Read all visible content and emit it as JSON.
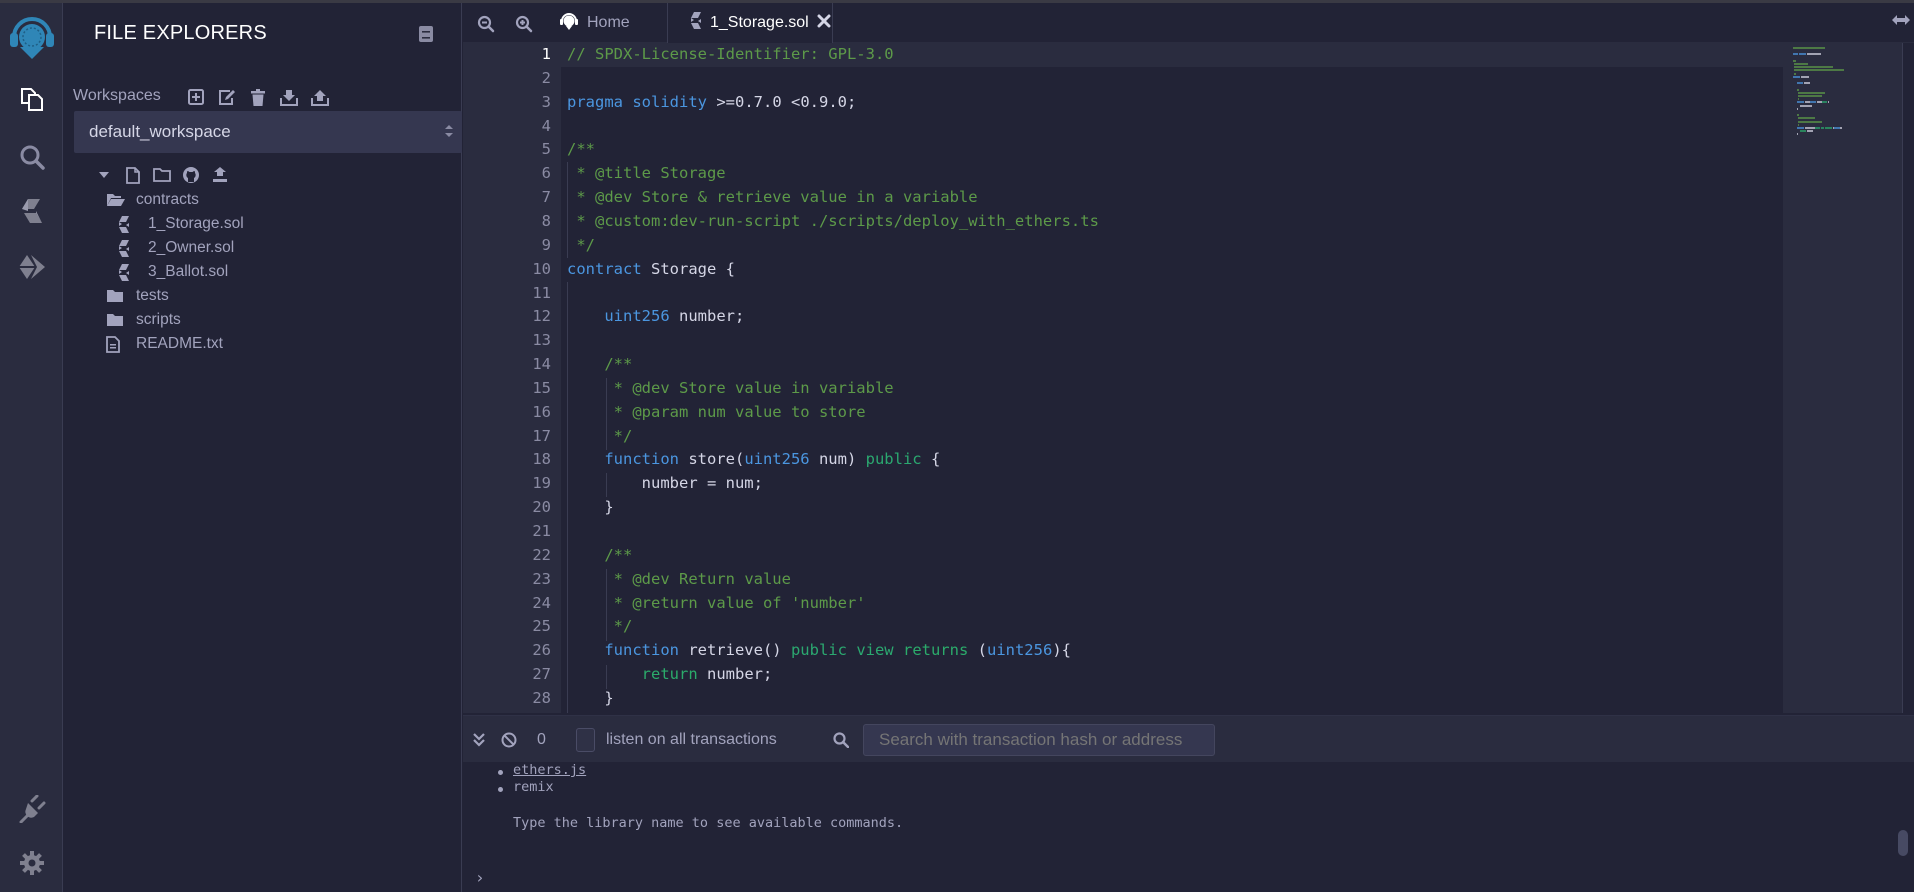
{
  "icon_bar": {
    "top_items": [
      {
        "name": "remix-logo-icon"
      },
      {
        "name": "file-explorer-icon"
      },
      {
        "name": "search-icon"
      },
      {
        "name": "solidity-compiler-icon"
      },
      {
        "name": "deploy-run-icon"
      }
    ],
    "bottom_items": [
      {
        "name": "plugin-manager-icon"
      },
      {
        "name": "settings-icon"
      }
    ]
  },
  "side_panel": {
    "title": "FILE EXPLORERS",
    "workspaces_label": "Workspaces",
    "workspace_tools": [
      "create-workspace",
      "rename-workspace",
      "delete-workspace",
      "download-workspace",
      "restore-workspace"
    ],
    "selected_workspace": "default_workspace",
    "tree_tools": [
      "collapse",
      "new-file",
      "new-folder",
      "github",
      "upload"
    ],
    "tree": [
      {
        "label": "contracts",
        "type": "folder-open",
        "depth": 0
      },
      {
        "label": "1_Storage.sol",
        "type": "solidity",
        "depth": 1
      },
      {
        "label": "2_Owner.sol",
        "type": "solidity",
        "depth": 1
      },
      {
        "label": "3_Ballot.sol",
        "type": "solidity",
        "depth": 1
      },
      {
        "label": "tests",
        "type": "folder",
        "depth": 0
      },
      {
        "label": "scripts",
        "type": "folder",
        "depth": 0
      },
      {
        "label": "README.txt",
        "type": "file",
        "depth": 0
      }
    ]
  },
  "tabs": {
    "home_label": "Home",
    "active_label": "1_Storage.sol"
  },
  "editor": {
    "current_line": 1,
    "lines": [
      [
        [
          "c",
          "// SPDX-License-Identifier: GPL-3.0"
        ]
      ],
      [],
      [
        [
          "k",
          "pragma"
        ],
        [
          "p",
          " "
        ],
        [
          "k",
          "solidity"
        ],
        [
          "p",
          " >=0.7.0 <0.9.0;"
        ]
      ],
      [],
      [
        [
          "c",
          "/**"
        ]
      ],
      [
        [
          "c",
          " * @title Storage"
        ]
      ],
      [
        [
          "c",
          " * @dev Store & retrieve value in a variable"
        ]
      ],
      [
        [
          "c",
          " * @custom:dev-run-script ./scripts/deploy_with_ethers.ts"
        ]
      ],
      [
        [
          "c",
          " */"
        ]
      ],
      [
        [
          "k",
          "contract"
        ],
        [
          "p",
          " Storage {"
        ]
      ],
      [],
      [
        [
          "p",
          "    "
        ],
        [
          "k",
          "uint256"
        ],
        [
          "p",
          " number;"
        ]
      ],
      [],
      [
        [
          "p",
          "    "
        ],
        [
          "c",
          "/**"
        ]
      ],
      [
        [
          "p",
          "     "
        ],
        [
          "c",
          "* @dev Store value in variable"
        ]
      ],
      [
        [
          "p",
          "     "
        ],
        [
          "c",
          "* @param num value to store"
        ]
      ],
      [
        [
          "p",
          "     "
        ],
        [
          "c",
          "*/"
        ]
      ],
      [
        [
          "p",
          "    "
        ],
        [
          "k",
          "function"
        ],
        [
          "p",
          " store("
        ],
        [
          "k",
          "uint256"
        ],
        [
          "p",
          " num) "
        ],
        [
          "t",
          "public"
        ],
        [
          "p",
          " {"
        ]
      ],
      [
        [
          "p",
          "        number = num;"
        ]
      ],
      [
        [
          "p",
          "    }"
        ]
      ],
      [],
      [
        [
          "p",
          "    "
        ],
        [
          "c",
          "/**"
        ]
      ],
      [
        [
          "p",
          "     "
        ],
        [
          "c",
          "* @dev Return value"
        ]
      ],
      [
        [
          "p",
          "     "
        ],
        [
          "c",
          "* @return value of 'number'"
        ]
      ],
      [
        [
          "p",
          "     "
        ],
        [
          "c",
          "*/"
        ]
      ],
      [
        [
          "p",
          "    "
        ],
        [
          "k",
          "function"
        ],
        [
          "p",
          " retrieve() "
        ],
        [
          "t",
          "public"
        ],
        [
          "p",
          " "
        ],
        [
          "t",
          "view"
        ],
        [
          "p",
          " "
        ],
        [
          "r",
          "returns"
        ],
        [
          "p",
          " ("
        ],
        [
          "k",
          "uint256"
        ],
        [
          "p",
          "){"
        ]
      ],
      [
        [
          "p",
          "        "
        ],
        [
          "r",
          "return"
        ],
        [
          "p",
          " number;"
        ]
      ],
      [
        [
          "p",
          "    }"
        ]
      ]
    ]
  },
  "terminal": {
    "tx_count": "0",
    "listen_label": "listen on all transactions",
    "listen_checked": false,
    "search_placeholder": "Search with transaction hash or address",
    "lines": {
      "lib1": "ethers.js",
      "lib2": "remix",
      "hint": "Type the library name to see available commands."
    },
    "prompt": "›"
  }
}
